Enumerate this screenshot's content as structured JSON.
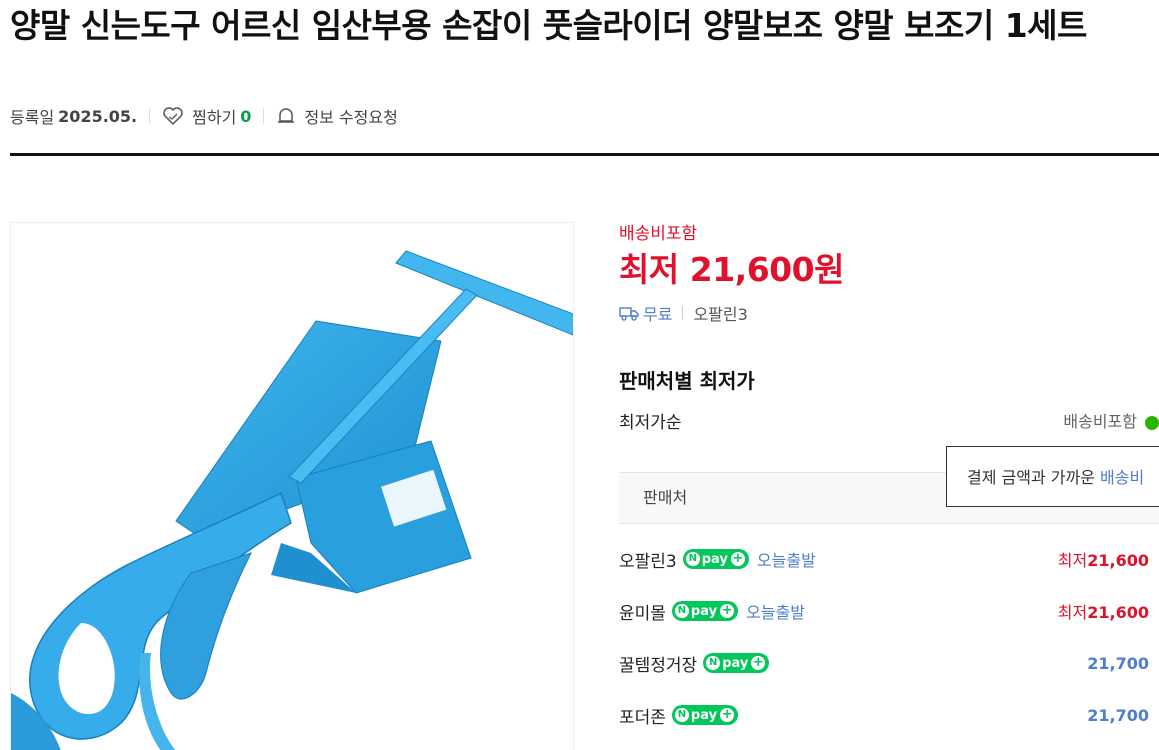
{
  "product": {
    "title": "양말 신는도구 어르신 임산부용 손잡이 풋슬라이더 양말보조 양말 보조기 1세트"
  },
  "meta": {
    "reg_label": "등록일",
    "reg_date": "2025.05.",
    "zzim_label": "찜하기",
    "zzim_count": "0",
    "report_label": "정보 수정요청"
  },
  "price": {
    "ship_included": "배송비포함",
    "lowest_label": "최저",
    "lowest_value": "21,600원",
    "ship_free": "무료",
    "seller": "오팔린3"
  },
  "seller_section": {
    "title": "판매처별 최저가",
    "sort_label": "최저가순",
    "ship_toggle_label": "배송비포함",
    "header_label": "판매처",
    "tooltip_text": "결제 금액과 가까운 ",
    "tooltip_link": "배송비"
  },
  "sellers": [
    {
      "name": "오팔린3",
      "npay": "pay",
      "delivery": "오늘출발",
      "price_label": "최저",
      "price": "21,600",
      "lowest": true
    },
    {
      "name": "윤미몰",
      "npay": "pay",
      "delivery": "오늘출발",
      "price_label": "최저",
      "price": "21,600",
      "lowest": true
    },
    {
      "name": "꿀템정거장",
      "npay": "pay",
      "delivery": "",
      "price_label": "",
      "price": "21,700",
      "lowest": false
    },
    {
      "name": "포더존",
      "npay": "pay",
      "delivery": "",
      "price_label": "",
      "price": "21,700",
      "lowest": false
    }
  ],
  "colors": {
    "price_red": "#e0112c",
    "link_blue": "#4f7ecf",
    "npay_green": "#03c75a",
    "product_blue": "#2ea3e0"
  },
  "icons": {
    "zzim": "heart-outline-icon",
    "report": "bell-icon",
    "truck": "truck-icon",
    "npay_n": "naver-n-icon",
    "npay_plus": "plus-icon"
  }
}
